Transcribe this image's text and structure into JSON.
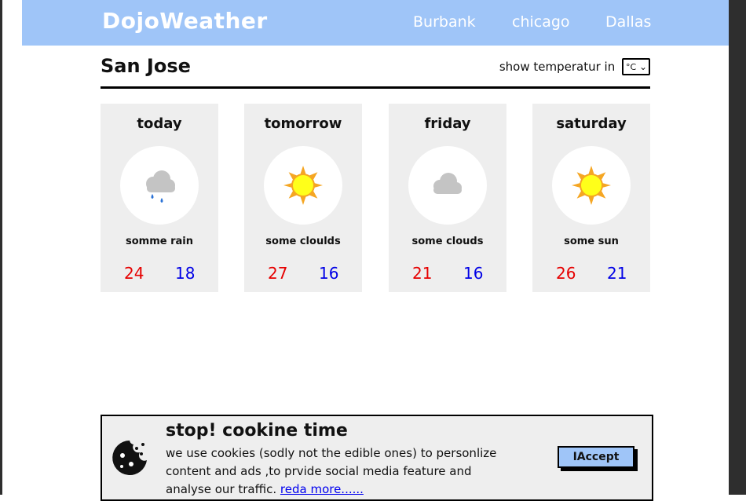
{
  "navbar": {
    "brand": "DojoWeather",
    "links": [
      "Burbank",
      "chicago",
      "Dallas"
    ]
  },
  "city": {
    "name": "San Jose",
    "unit_label": "show temperatur in",
    "unit_selected": "°C"
  },
  "forecast": [
    {
      "day": "today",
      "icon": "rain-cloud-icon",
      "condition": "somme rain",
      "high": "24",
      "low": "18"
    },
    {
      "day": "tomorrow",
      "icon": "sun-icon",
      "condition": "some cloulds",
      "high": "27",
      "low": "16"
    },
    {
      "day": "friday",
      "icon": "cloud-icon",
      "condition": "some clouds",
      "high": "21",
      "low": "16"
    },
    {
      "day": "saturday",
      "icon": "sun-icon",
      "condition": "some sun",
      "high": "26",
      "low": "21"
    }
  ],
  "cookie": {
    "title": "stop! cookine time",
    "text": "we use cookies (sodly not the edible ones) to personlize content and ads ,to prvide social media feature and analyse our traffic.",
    "link": "reda more......",
    "button": "IAccept"
  },
  "colors": {
    "navbar": "#9fc5f8",
    "card": "#eeeeee",
    "high_temp": "#e60000",
    "low_temp": "#0000e6"
  }
}
